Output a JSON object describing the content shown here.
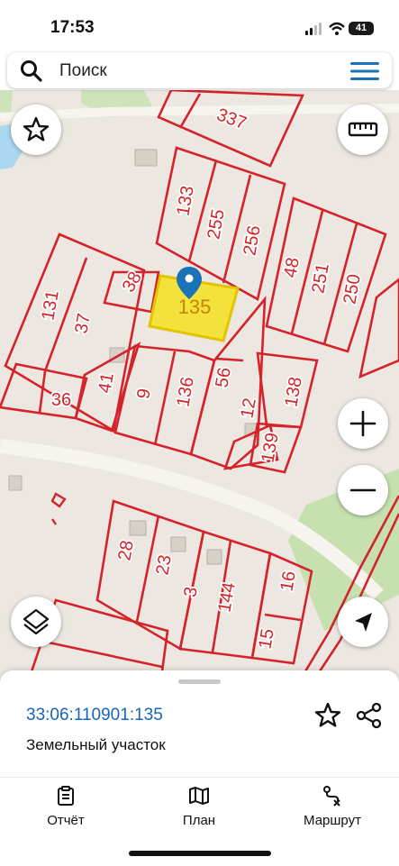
{
  "status_bar": {
    "time": "17:53",
    "battery": "41"
  },
  "search": {
    "placeholder": "Поиск"
  },
  "icons": {
    "search": "search-icon",
    "menu": "hamburger-menu-icon",
    "favorite": "star-icon",
    "ruler": "ruler-icon",
    "zoom_in": "plus-icon",
    "zoom_out": "minus-icon",
    "layers": "layers-icon",
    "locate": "navigation-arrow-icon",
    "marker": "location-pin-icon",
    "share": "share-icon",
    "report": "clipboard-icon",
    "plan": "map-icon",
    "route": "route-icon"
  },
  "colors": {
    "parcel_border": "#d4232b",
    "selected_fill": "#f5e11c",
    "marker": "#1a73b8",
    "link": "#1565b8"
  },
  "map": {
    "parcel_labels": [
      "337",
      "133",
      "255",
      "256",
      "48",
      "251",
      "250",
      "38",
      "135",
      "131",
      "37",
      "36",
      "41",
      "9",
      "136",
      "56",
      "12",
      "138",
      "139",
      "28",
      "23",
      "3",
      "144",
      "16",
      "15"
    ],
    "selected_parcel": "135"
  },
  "parcel_card": {
    "cadastral_number": "33:06:110901:135",
    "type": "Земельный участок"
  },
  "nav": {
    "report": "Отчёт",
    "plan": "План",
    "route": "Маршрут"
  }
}
